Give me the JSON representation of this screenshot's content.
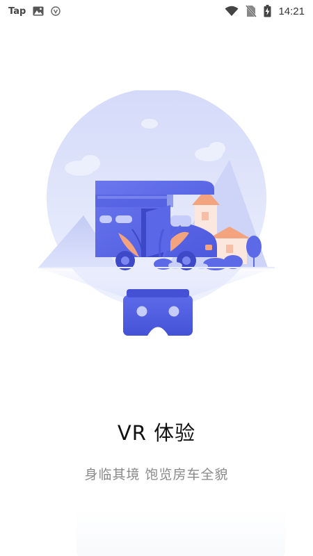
{
  "status_bar": {
    "app_label": "Tap",
    "time": "14:21",
    "icons": [
      "image-icon",
      "shield-icon",
      "wifi-icon",
      "no-sim-icon",
      "battery-charging-icon"
    ]
  },
  "illustration": {
    "subject": "vr-camper-van-illustration"
  },
  "content": {
    "title": "VR 体验",
    "subtitle": "身临其境 饱览房车全貌"
  },
  "colors": {
    "accent": "#5765e6",
    "circle_bg": "#dfe4fb",
    "title_text": "#111111",
    "subtitle_text": "#8a8a8a"
  }
}
